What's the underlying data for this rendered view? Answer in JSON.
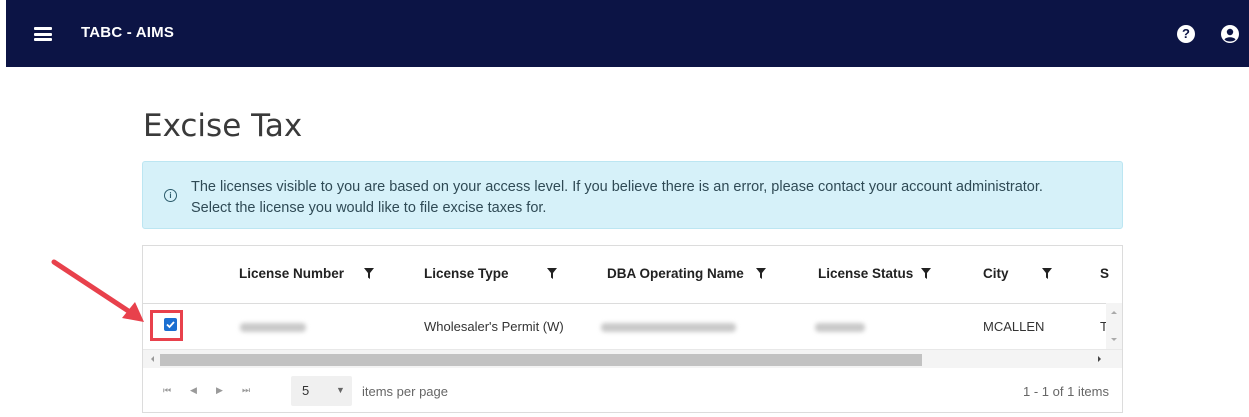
{
  "app": {
    "title": "TABC - AIMS"
  },
  "icons": {
    "menu": "hamburger-menu-icon",
    "help": "question-circle-icon",
    "user": "user-circle-icon",
    "info": "info-circle-icon",
    "filter": "funnel-filter-icon"
  },
  "page": {
    "title": "Excise Tax"
  },
  "alert": {
    "text": "The licenses visible to you are based on your access level. If you believe there is an error, please contact your account administrator. Select the license you would like to file excise taxes for."
  },
  "grid": {
    "columns": [
      "License Number",
      "License Type",
      "DBA Operating Name",
      "License Status",
      "City",
      "S"
    ],
    "rows": [
      {
        "selected": true,
        "license_number": "",
        "license_type": "Wholesaler's Permit (W)",
        "dba_name": "",
        "status": "",
        "city": "MCALLEN",
        "next": "T"
      }
    ]
  },
  "pager": {
    "page_size": "5",
    "items_per_page_label": "items per page",
    "count_label": "1 - 1 of 1 items"
  },
  "colors": {
    "topbar": "#0c1445",
    "alert_bg": "#d6f1f9",
    "checkbox": "#1b6fd1",
    "annotation": "#e8414c"
  }
}
